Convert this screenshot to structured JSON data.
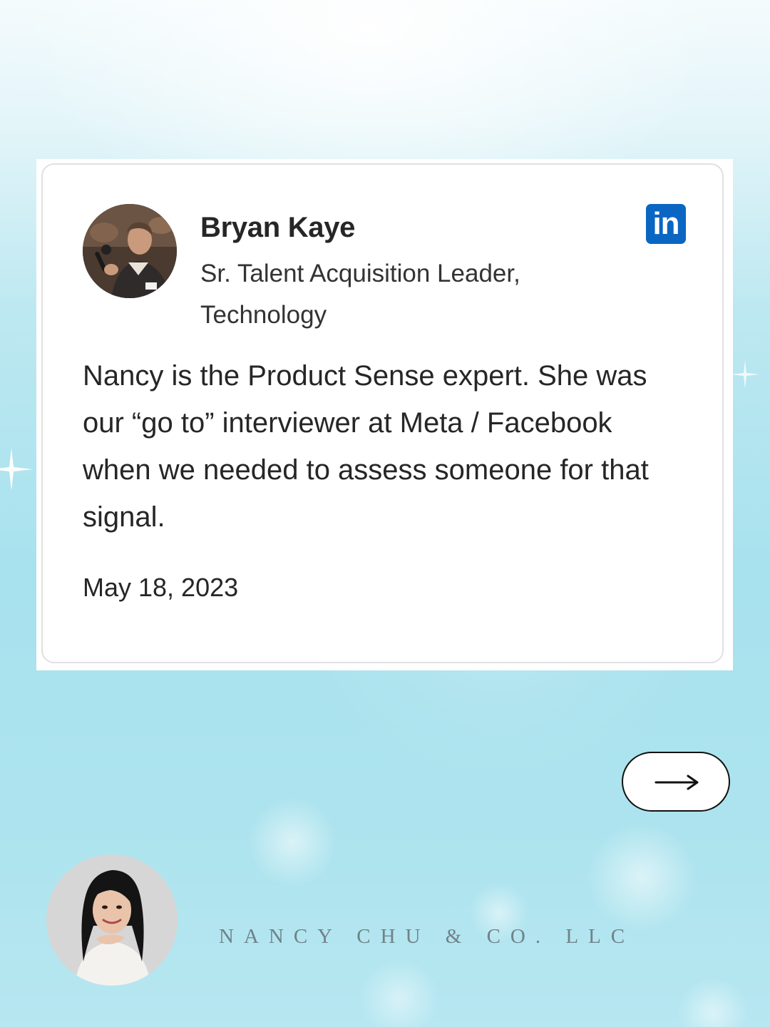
{
  "testimonial": {
    "name": "Bryan Kaye",
    "role": "Sr. Talent Acquisition Leader, Technology",
    "quote": "Nancy is the Product Sense expert. She was our “go to” interviewer at Meta / Facebook when we needed to assess someone for that signal.",
    "date": "May 18, 2023",
    "source_badge": "in",
    "source_icon": "linkedin-icon",
    "source_color": "#0a66c2"
  },
  "navigation": {
    "next_icon": "arrow-right-icon"
  },
  "brand": {
    "name": "NANCY CHU & CO. LLC",
    "photo": "nancy-portrait"
  },
  "colors": {
    "background_top": "#f4fbfd",
    "background_main": "#a8e2ee",
    "brand_text": "#6f8288"
  }
}
